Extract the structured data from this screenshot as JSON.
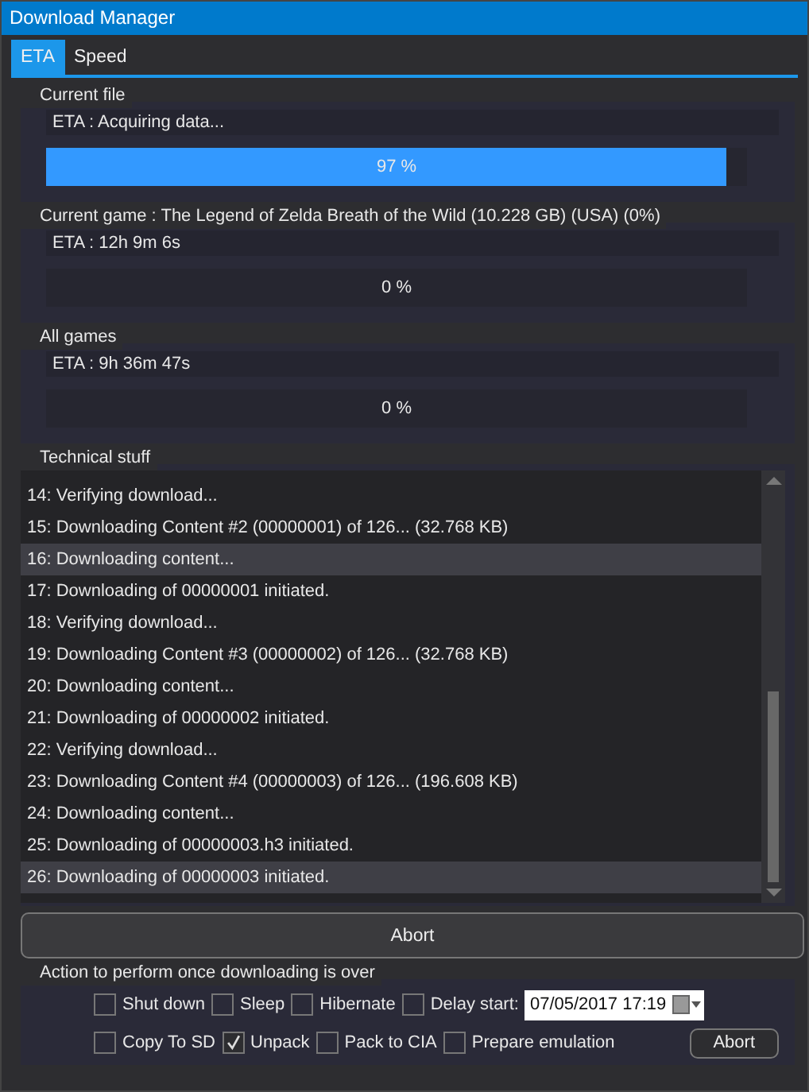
{
  "window": {
    "title": "Download Manager"
  },
  "tabs": [
    {
      "label": "ETA",
      "selected": true
    },
    {
      "label": "Speed",
      "selected": false
    }
  ],
  "progress_groups": [
    {
      "title": "Current file",
      "eta": "ETA : Acquiring data...",
      "level": 0.97,
      "reading": "97 %"
    },
    {
      "title": "Current game : The Legend of Zelda Breath of the Wild (10.228 GB) (USA) (0%)",
      "eta": "ETA : 12h 9m 6s",
      "level": 0,
      "reading": "0 %"
    },
    {
      "title": "All games",
      "eta": "ETA : 9h 36m 47s",
      "level": 0,
      "reading": "0 %"
    }
  ],
  "log": {
    "title": "Technical stuff",
    "rows": [
      {
        "text": "14: Verifying download...",
        "selected": false
      },
      {
        "text": "15: Downloading Content #2 (00000001) of 126... (32.768 KB)",
        "selected": false
      },
      {
        "text": "16: Downloading content...",
        "selected": true
      },
      {
        "text": "17: Downloading of 00000001 initiated.",
        "selected": false
      },
      {
        "text": "18: Verifying download...",
        "selected": false
      },
      {
        "text": "19: Downloading Content #3 (00000002) of 126... (32.768 KB)",
        "selected": false
      },
      {
        "text": "20: Downloading content...",
        "selected": false
      },
      {
        "text": "21: Downloading of 00000002 initiated.",
        "selected": false
      },
      {
        "text": "22: Verifying download...",
        "selected": false
      },
      {
        "text": "23: Downloading Content #4 (00000003) of 126... (196.608 KB)",
        "selected": false
      },
      {
        "text": "24: Downloading content...",
        "selected": false
      },
      {
        "text": "25: Downloading of 00000003.h3 initiated.",
        "selected": false
      },
      {
        "text": "26: Downloading of 00000003 initiated.",
        "selected": true
      }
    ]
  },
  "abort_button": "Abort",
  "actions": {
    "title": "Action to perform once downloading is over",
    "row_1": [
      {
        "label": "Shut down",
        "checked": false
      },
      {
        "label": "Sleep",
        "checked": false
      },
      {
        "label": "Hibernate",
        "checked": false
      },
      {
        "label": "Delay start:",
        "checked": false
      }
    ],
    "date_value": "07/05/2017 17:19",
    "row_2": [
      {
        "label": "Copy To SD",
        "checked": false
      },
      {
        "label": "Unpack",
        "checked": true
      },
      {
        "label": "Pack to CIA",
        "checked": false
      },
      {
        "label": "Prepare emulation",
        "checked": false
      }
    ],
    "abort_button": "Abort"
  }
}
